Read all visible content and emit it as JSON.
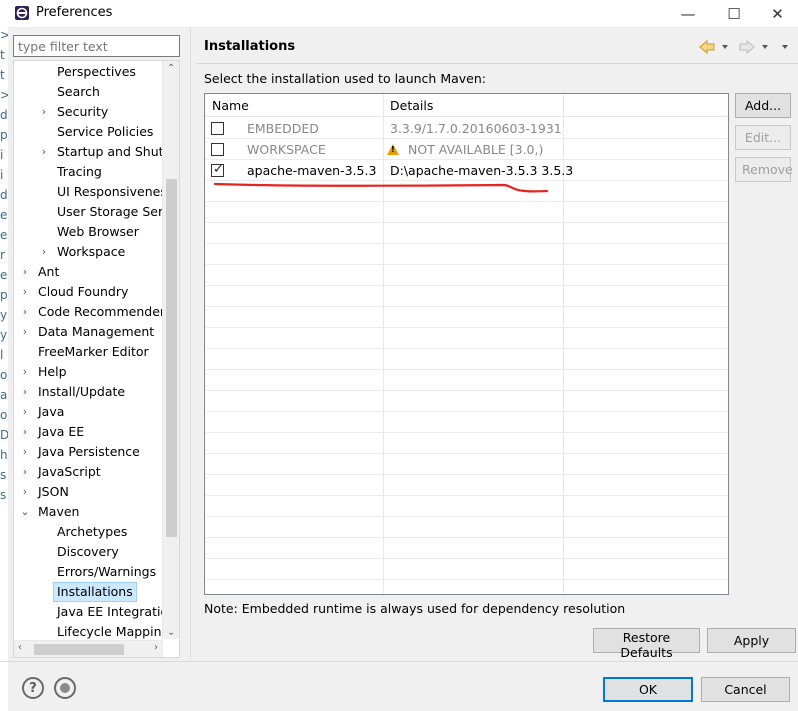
{
  "window": {
    "title": "Preferences",
    "minimize_glyph": "—",
    "maximize_glyph": "☐",
    "close_glyph": "✕"
  },
  "background_letters": [
    ">",
    "t",
    "t",
    ">",
    "d",
    "p",
    "i",
    "i",
    "d",
    "e",
    "e",
    "r",
    "e",
    "p",
    "y",
    "y",
    "l",
    "o",
    "a",
    "o",
    "D",
    "h",
    "s",
    "s"
  ],
  "sidebar": {
    "filter_placeholder": "type filter text",
    "items": [
      {
        "label": "Perspectives",
        "level": 1,
        "arrow": ""
      },
      {
        "label": "Search",
        "level": 1,
        "arrow": ""
      },
      {
        "label": "Security",
        "level": 1,
        "arrow": "›"
      },
      {
        "label": "Service Policies",
        "level": 1,
        "arrow": ""
      },
      {
        "label": "Startup and Shutd",
        "level": 1,
        "arrow": "›"
      },
      {
        "label": "Tracing",
        "level": 1,
        "arrow": ""
      },
      {
        "label": "UI Responsiveness",
        "level": 1,
        "arrow": ""
      },
      {
        "label": "User Storage Serv",
        "level": 1,
        "arrow": ""
      },
      {
        "label": "Web Browser",
        "level": 1,
        "arrow": ""
      },
      {
        "label": "Workspace",
        "level": 1,
        "arrow": "›"
      },
      {
        "label": "Ant",
        "level": 0,
        "arrow": "›"
      },
      {
        "label": "Cloud Foundry",
        "level": 0,
        "arrow": "›"
      },
      {
        "label": "Code Recommenders",
        "level": 0,
        "arrow": "›"
      },
      {
        "label": "Data Management",
        "level": 0,
        "arrow": "›"
      },
      {
        "label": "FreeMarker Editor",
        "level": 0,
        "arrow": ""
      },
      {
        "label": "Help",
        "level": 0,
        "arrow": "›"
      },
      {
        "label": "Install/Update",
        "level": 0,
        "arrow": "›"
      },
      {
        "label": "Java",
        "level": 0,
        "arrow": "›"
      },
      {
        "label": "Java EE",
        "level": 0,
        "arrow": "›"
      },
      {
        "label": "Java Persistence",
        "level": 0,
        "arrow": "›"
      },
      {
        "label": "JavaScript",
        "level": 0,
        "arrow": "›"
      },
      {
        "label": "JSON",
        "level": 0,
        "arrow": "›"
      },
      {
        "label": "Maven",
        "level": 0,
        "arrow": "⌄"
      },
      {
        "label": "Archetypes",
        "level": 1,
        "arrow": ""
      },
      {
        "label": "Discovery",
        "level": 1,
        "arrow": ""
      },
      {
        "label": "Errors/Warnings",
        "level": 1,
        "arrow": ""
      },
      {
        "label": "Installations",
        "level": 1,
        "arrow": "",
        "selected": true
      },
      {
        "label": "Java EE Integration",
        "level": 1,
        "arrow": ""
      },
      {
        "label": "Lifecycle Mapping",
        "level": 1,
        "arrow": ""
      }
    ]
  },
  "main": {
    "title": "Installations",
    "instruction": "Select the installation used to launch Maven:",
    "columns": [
      "Name",
      "Details"
    ],
    "rows": [
      {
        "checked": false,
        "name": "EMBEDDED",
        "details": "3.3.9/1.7.0.20160603-1931",
        "muted": true,
        "warning": false
      },
      {
        "checked": false,
        "name": "WORKSPACE",
        "details": "NOT AVAILABLE [3.0,)",
        "muted": true,
        "warning": true
      },
      {
        "checked": true,
        "name": "apache-maven-3.5.3",
        "details": "D:\\apache-maven-3.5.3 3.5.3",
        "muted": false,
        "warning": false
      }
    ],
    "buttons": {
      "add": "Add...",
      "edit": "Edit...",
      "remove": "Remove"
    },
    "note": "Note: Embedded runtime is always used for dependency resolution",
    "restore_defaults": "Restore Defaults",
    "apply": "Apply"
  },
  "footer": {
    "help_glyph": "?",
    "ok": "OK",
    "cancel": "Cancel"
  },
  "colors": {
    "selection": "#cce8ff",
    "annotation_red": "#e8231e",
    "default_button_border": "#0078d7"
  }
}
